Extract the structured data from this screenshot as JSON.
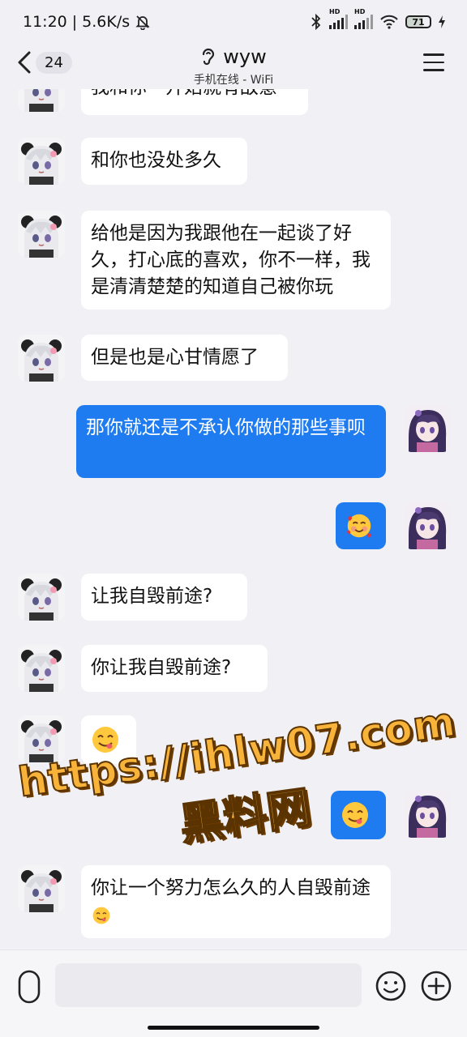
{
  "status_bar": {
    "time": "11:20",
    "net_speed": "5.6K/s",
    "battery": "71",
    "sim1_label": "HD",
    "sim2_label": "HD"
  },
  "header": {
    "unread_count": "24",
    "contact_name": "wyw",
    "online_status": "手机在线 - WiFi"
  },
  "messages": [
    {
      "side": "in",
      "text": "我和你一开始就有敌意"
    },
    {
      "side": "in",
      "text": "和你也没处多久"
    },
    {
      "side": "in",
      "text": "给他是因为我跟他在一起谈了好久，打心底的喜欢，你不一样，我是清清楚楚的知道自己被你玩"
    },
    {
      "side": "in",
      "text": "但是也是心甘情愿了"
    },
    {
      "side": "out",
      "text": "那你就还是不承认你做的那些事呗"
    },
    {
      "side": "out",
      "emoji": "smiling-face-with-hearts"
    },
    {
      "side": "in",
      "text": "让我自毁前途?"
    },
    {
      "side": "in",
      "text": "你让我自毁前途?"
    },
    {
      "side": "in",
      "emoji": "yum-face"
    },
    {
      "side": "out",
      "emoji": "yum-face"
    },
    {
      "side": "in",
      "text": "你让一个努力怎么久的人自毁前途",
      "emoji": "yum-face"
    }
  ],
  "watermark": {
    "line1": "https://ihlw07.com",
    "line2": "黑料网"
  },
  "colors": {
    "outgoing_bubble": "#1e7bf0",
    "incoming_bubble": "#ffffff",
    "background": "#f1f1f5"
  }
}
